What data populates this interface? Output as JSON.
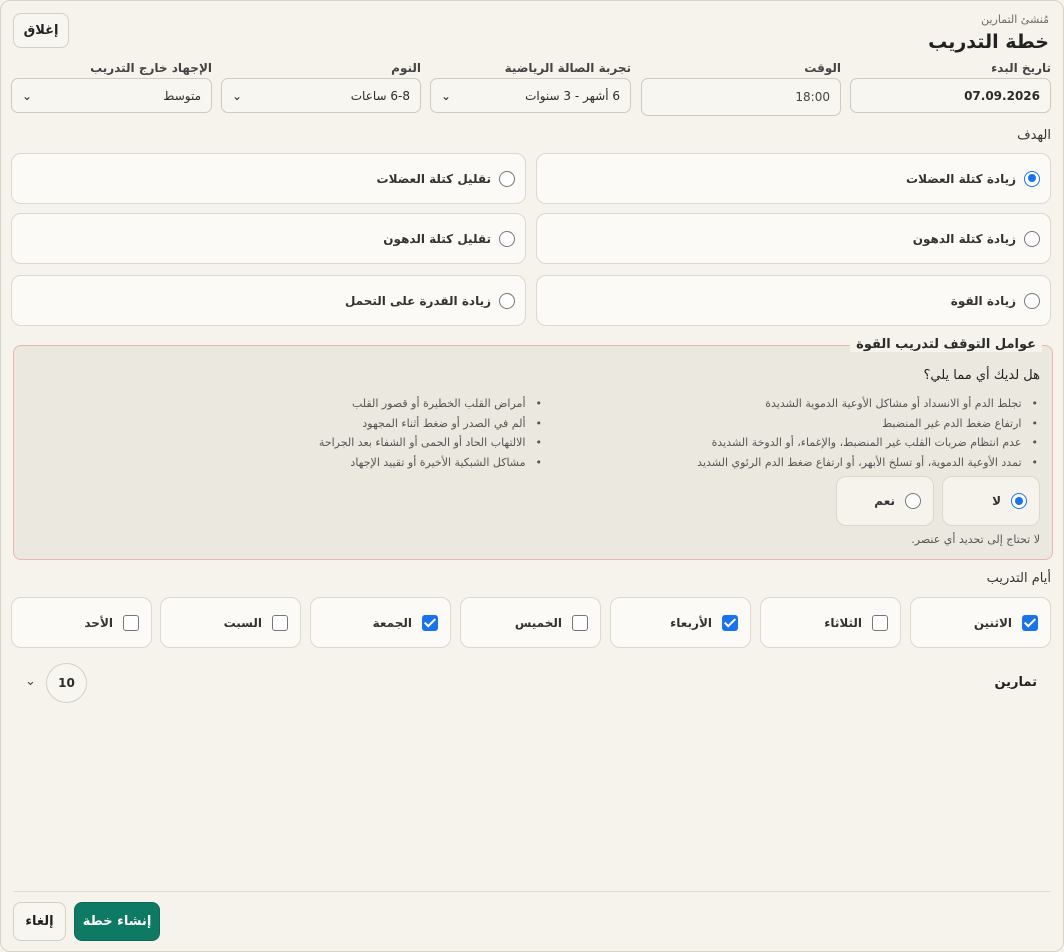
{
  "header": {
    "subtitle": "مُنشئ التمارين",
    "title": "خطة التدريب",
    "close_label": "إغلاق"
  },
  "fields": {
    "start_date": {
      "label": "تاريخ البدء",
      "value": "07.09.2026"
    },
    "time": {
      "label": "الوقت",
      "value": "18:00"
    },
    "gym_experience": {
      "label": "تجربة الصالة الرياضية",
      "value": "6 أشهر - 3 سنوات"
    },
    "sleep": {
      "label": "النوم",
      "value": "6-8 ساعات"
    },
    "outside_stress": {
      "label": "الإجهاد خارج التدريب",
      "value": "متوسط"
    }
  },
  "goal": {
    "label": "الهدف",
    "options": [
      {
        "label": "زيادة كتلة العضلات",
        "selected": true
      },
      {
        "label": "تقليل كتلة العضلات",
        "selected": false
      },
      {
        "label": "زيادة كتلة الدهون",
        "selected": false
      },
      {
        "label": "تقليل كتلة الدهون",
        "selected": false
      },
      {
        "label": "زيادة القوة",
        "selected": false
      },
      {
        "label": "زيادة القدرة على التحمل",
        "selected": false
      }
    ]
  },
  "stop_factors": {
    "legend": "عوامل التوقف لتدريب القوة",
    "question": "هل لديك أي مما يلي؟",
    "right_list": [
      "تجلط الدم أو الانسداد أو مشاكل الأوعية الدموية الشديدة",
      "ارتفاع ضغط الدم غير المنضبط",
      "عدم انتظام ضربات القلب غير المنضبط، والإغماء، أو الدوخة الشديدة",
      "تمدد الأوعية الدموية، أو تسلخ الأبهر، أو ارتفاع ضغط الدم الرئوي الشديد"
    ],
    "left_list": [
      "أمراض القلب الخطيرة أو قصور القلب",
      "ألم في الصدر أو ضغط أثناء المجهود",
      "الالتهاب الحاد أو الحمى أو الشفاء بعد الجراحة",
      "مشاكل الشبكية الأخيرة أو تقييد الإجهاد"
    ],
    "no_label": "لا",
    "yes_label": "نعم",
    "selected": "no",
    "hint": "لا تحتاج إلى تحديد أي عنصر."
  },
  "training_days": {
    "label": "أيام التدريب",
    "days": [
      {
        "label": "الاثنين",
        "checked": true
      },
      {
        "label": "الثلاثاء",
        "checked": false
      },
      {
        "label": "الأربعاء",
        "checked": true
      },
      {
        "label": "الخميس",
        "checked": false
      },
      {
        "label": "الجمعة",
        "checked": true
      },
      {
        "label": "السبت",
        "checked": false
      },
      {
        "label": "الأحد",
        "checked": false
      }
    ]
  },
  "exercises": {
    "label": "تمارين",
    "count": "10"
  },
  "footer": {
    "create_label": "إنشاء خطة",
    "cancel_label": "إلغاء"
  },
  "colors": {
    "accent": "#1a73e8",
    "primary_button": "#0e7a63",
    "warning_border": "#e6b8b0"
  }
}
